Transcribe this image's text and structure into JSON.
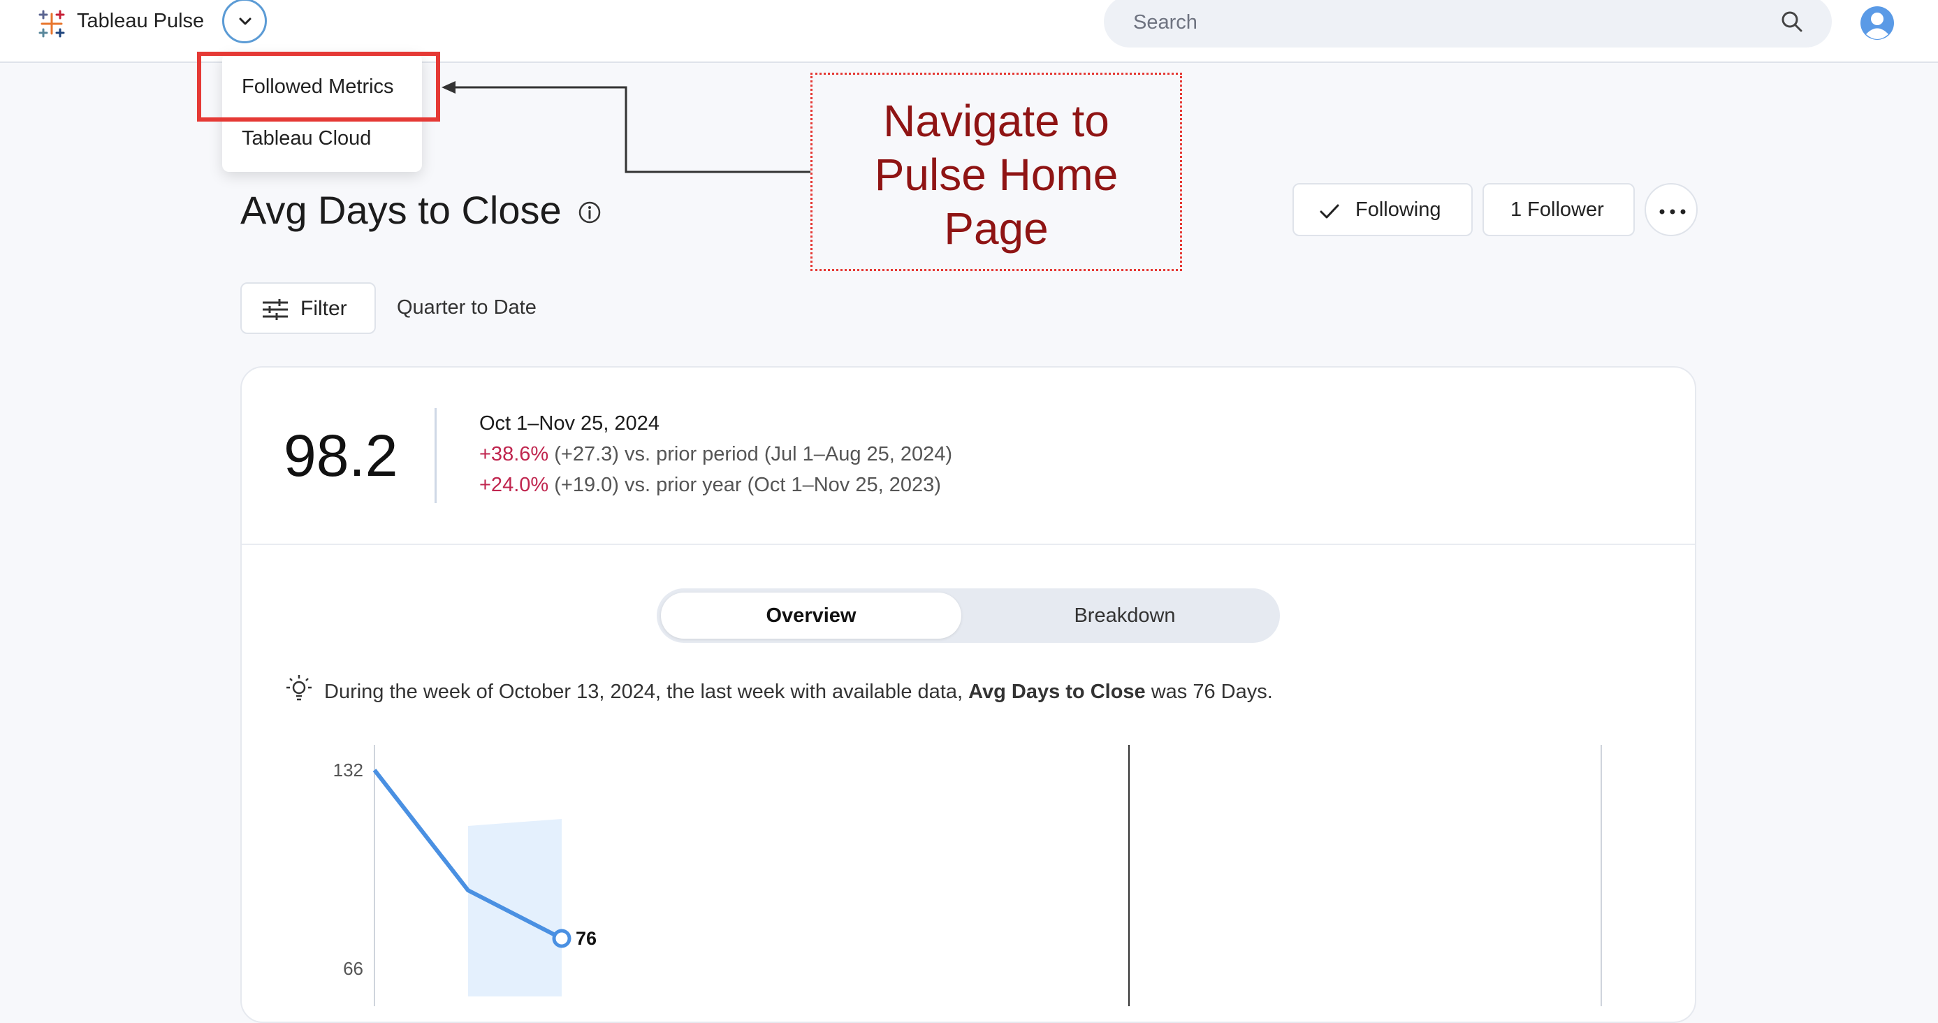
{
  "header": {
    "app_title": "Tableau Pulse",
    "search_placeholder": "Search"
  },
  "nav_menu": {
    "items": [
      {
        "label": "Followed Metrics",
        "highlighted": true
      },
      {
        "label": "Tableau Cloud"
      }
    ]
  },
  "annotation": {
    "callout_lines": [
      "Navigate to",
      "Pulse Home",
      "Page"
    ],
    "color": "#8f1414",
    "highlight_color": "#e53935"
  },
  "metric": {
    "title": "Avg Days to Close",
    "following_label": "Following",
    "followers_label": "1 Follower"
  },
  "filters": {
    "filter_label": "Filter",
    "period": "Quarter to Date"
  },
  "kpi": {
    "value": "98.2",
    "date_range": "Oct 1–Nov 25, 2024",
    "prior_period_pct": "+38.6%",
    "prior_period_rest": " (+27.3) vs. prior period (Jul 1–Aug 25, 2024)",
    "prior_year_pct": "+24.0%",
    "prior_year_rest": " (+19.0) vs. prior year (Oct 1–Nov 25, 2023)",
    "change_color": "#c0264f"
  },
  "tabs": {
    "overview": "Overview",
    "breakdown": "Breakdown",
    "active": "Overview"
  },
  "insight": {
    "prefix": "During the week of October 13, 2024, the last week with available data, ",
    "metric_name": "Avg Days to Close",
    "suffix": " was 76 Days."
  },
  "chart_data": {
    "type": "line",
    "y_ticks": [
      132,
      66
    ],
    "series": [
      {
        "values": [
          132,
          92,
          76
        ],
        "color": "#4a90e2"
      }
    ],
    "last_point_label": "76",
    "band": {
      "weeks": [
        1,
        2
      ],
      "color": "#e4f0fd"
    }
  }
}
